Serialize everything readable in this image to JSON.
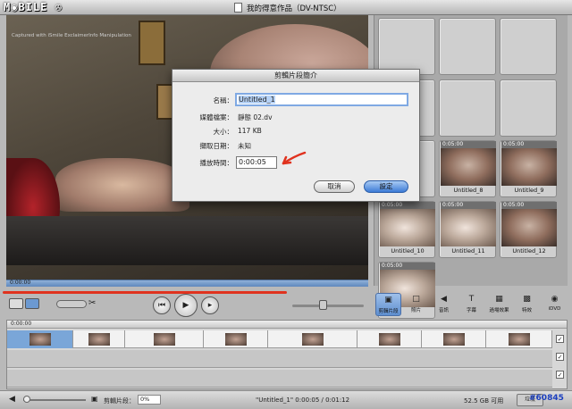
{
  "window": {
    "title": "我的得意作品（DV-NTSC）",
    "watermark_logo": "MOBILE"
  },
  "viewer": {
    "caption": "Captured with iSmile ExclaimerInfo Manipulation",
    "timecode": "0:00:00"
  },
  "clips": [
    {
      "duration": "",
      "label": ""
    },
    {
      "duration": "",
      "label": ""
    },
    {
      "duration": "",
      "label": ""
    },
    {
      "duration": "",
      "label": ""
    },
    {
      "duration": "",
      "label": ""
    },
    {
      "duration": "",
      "label": ""
    },
    {
      "duration": "",
      "label": ""
    },
    {
      "duration": "0:05:00",
      "label": "Untitled_8"
    },
    {
      "duration": "0:05:00",
      "label": "Untitled_9"
    },
    {
      "duration": "0:05:00",
      "label": "Untitled_10"
    },
    {
      "duration": "0:05:00",
      "label": "Untitled_11"
    },
    {
      "duration": "0:05:00",
      "label": "Untitled_12"
    },
    {
      "duration": "0:05:00",
      "label": ""
    }
  ],
  "tools": [
    {
      "label": "剪輯片段",
      "icon": "film-clip-icon",
      "active": true
    },
    {
      "label": "照片",
      "icon": "photo-icon"
    },
    {
      "label": "音訊",
      "icon": "speaker-icon"
    },
    {
      "label": "字幕",
      "icon": "text-icon"
    },
    {
      "label": "過場效果",
      "icon": "transition-icon"
    },
    {
      "label": "特效",
      "icon": "effects-icon"
    },
    {
      "label": "iDVD",
      "icon": "dvd-icon"
    }
  ],
  "timeline": {
    "timecode": "0:00:00"
  },
  "bottom": {
    "clip_label": "剪輯片段：",
    "percent": "0%",
    "status": "\"Untitled_1\"  0:00:05 / 0:01:12",
    "disk": "52.5 GB 可用",
    "trash": "垃圾"
  },
  "dialog": {
    "title": "剪輯片段簡介",
    "name_label": "名稱：",
    "name_value": "Untitled_1",
    "file_label": "媒體檔案：",
    "file_value": "靜態 02.dv",
    "size_label": "大小：",
    "size_value": "117 KB",
    "date_label": "擷取日期：",
    "date_value": "未知",
    "duration_label": "播放時間：",
    "duration_value": "0:00:05",
    "cancel": "取消",
    "ok": "設定"
  },
  "watermark": "#60845",
  "colors": {
    "accent": "#3c7bd6",
    "annotation": "#e0321e",
    "selection": "#7aa6d8"
  }
}
